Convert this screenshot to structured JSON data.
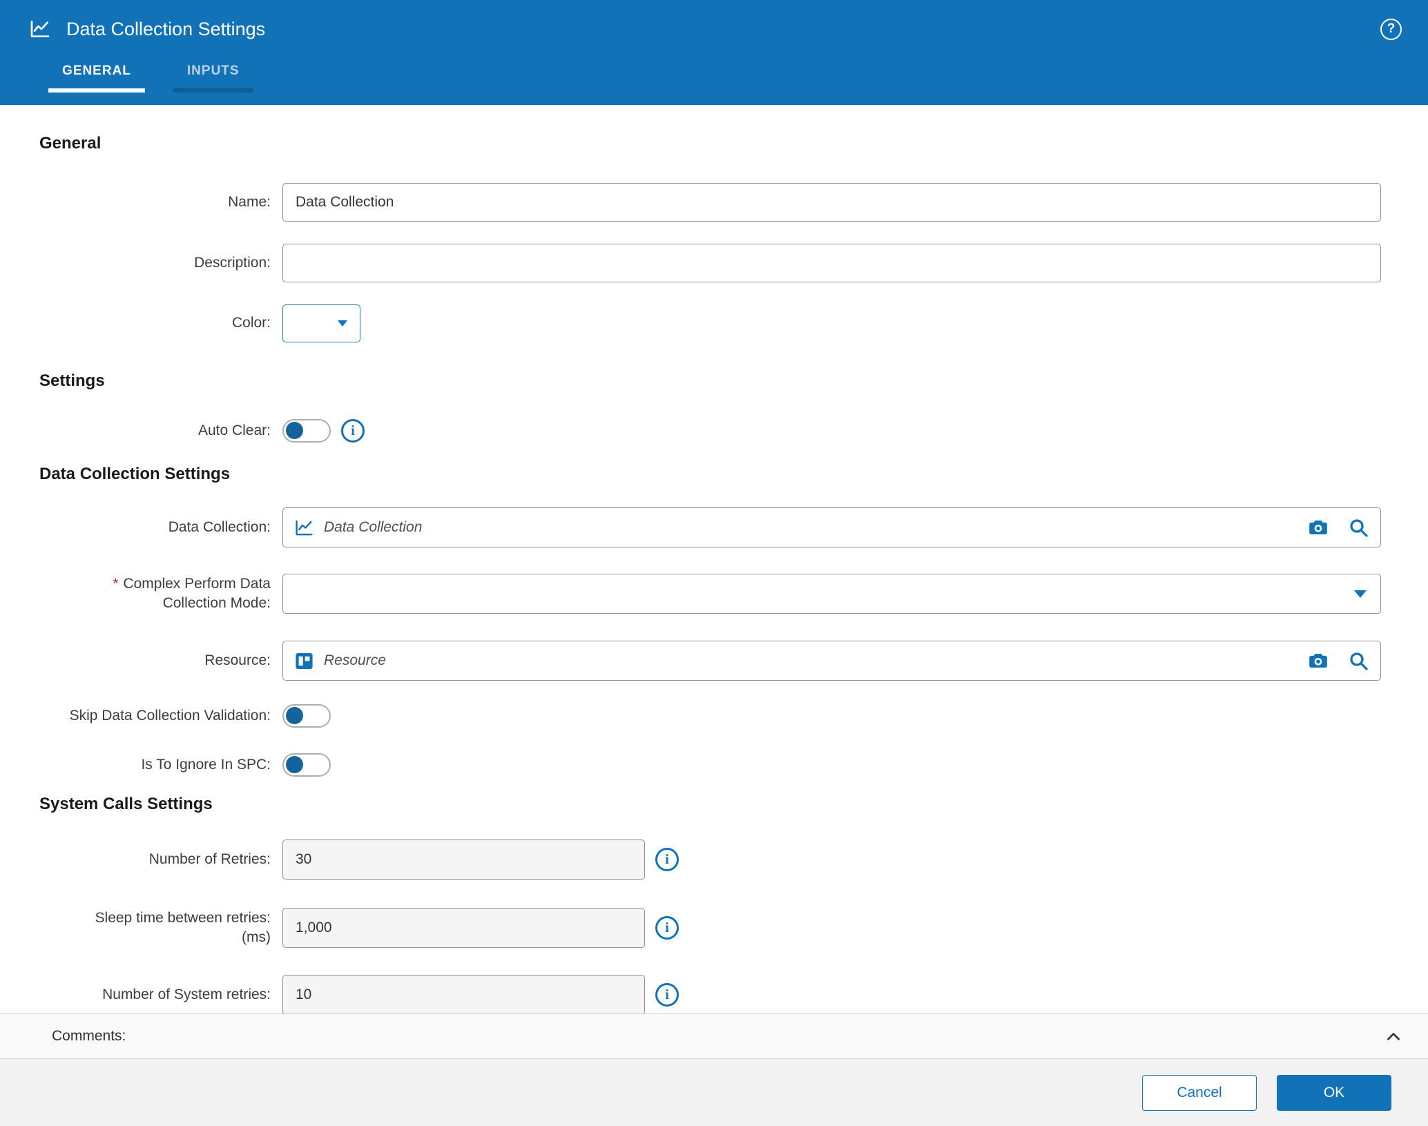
{
  "colors": {
    "accent_blue": "#1272b8",
    "header_bg": "#1272b8",
    "required_red": "#b0302a",
    "toggle_knob": "#15639d"
  },
  "icons": {
    "help": "?",
    "info": "i"
  },
  "header": {
    "title": "Data Collection Settings",
    "tabs": [
      {
        "label": "GENERAL",
        "active": true
      },
      {
        "label": "INPUTS",
        "active": false
      }
    ]
  },
  "general": {
    "heading": "General",
    "name_label": "Name:",
    "name_value": "Data Collection",
    "description_label": "Description:",
    "description_value": "",
    "color_label": "Color:",
    "color_value": ""
  },
  "settings": {
    "heading": "Settings",
    "auto_clear_label": "Auto Clear:",
    "auto_clear_state": "off"
  },
  "dc_settings": {
    "heading": "Data Collection Settings",
    "data_collection_label": "Data Collection:",
    "data_collection_text": "Data Collection",
    "complex_required_mark": "*",
    "complex_label_line1": "Complex Perform Data",
    "complex_label_line2": "Collection Mode:",
    "complex_value": "",
    "resource_label": "Resource:",
    "resource_text": "Resource",
    "skip_validation_label": "Skip Data Collection Validation:",
    "skip_validation_state": "off",
    "ignore_spc_label": "Is To Ignore In SPC:",
    "ignore_spc_state": "off"
  },
  "system_calls": {
    "heading": "System Calls Settings",
    "retries_label": "Number of Retries:",
    "retries_value": "30",
    "sleep_label_line1": "Sleep time between retries:",
    "sleep_label_line2": "(ms)",
    "sleep_value": "1,000",
    "system_retries_label": "Number of System retries:",
    "system_retries_value": "10"
  },
  "comments": {
    "label": "Comments:"
  },
  "footer": {
    "cancel_label": "Cancel",
    "ok_label": "OK"
  }
}
